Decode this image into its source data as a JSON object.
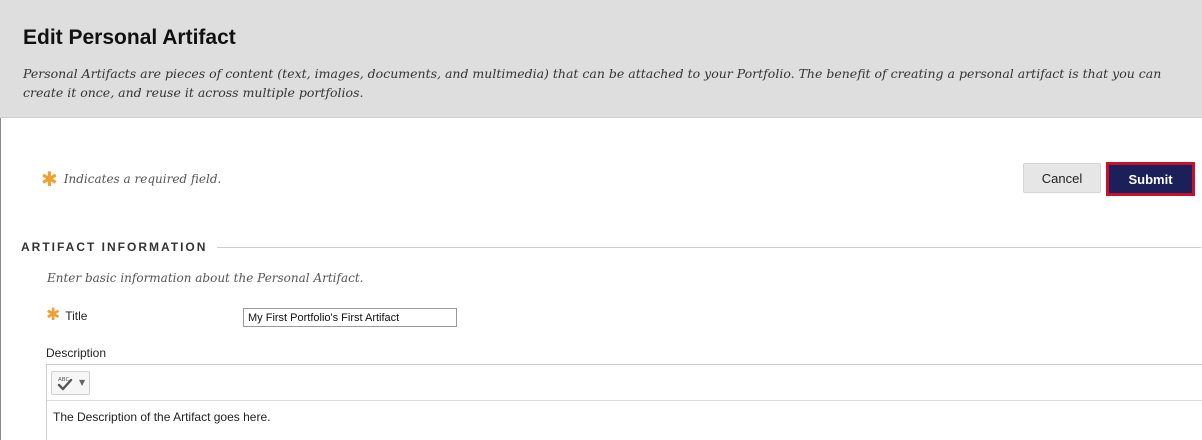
{
  "header": {
    "title": "Edit Personal Artifact",
    "description": "Personal Artifacts are pieces of content (text, images, documents, and multimedia) that can be attached to your Portfolio. The benefit of creating a personal artifact is that you can create it once, and reuse it across multiple portfolios."
  },
  "required_note": {
    "icon": "asterisk-icon",
    "text": "Indicates a required field."
  },
  "actions": {
    "cancel_label": "Cancel",
    "submit_label": "Submit"
  },
  "section": {
    "title": "ARTIFACT INFORMATION",
    "help": "Enter basic information about the Personal Artifact."
  },
  "fields": {
    "title_label": "Title",
    "title_value": "My First Portfolio's First Artifact",
    "description_label": "Description",
    "description_value": "The Description of the Artifact goes here."
  },
  "editor_toolbar": {
    "spellcheck_icon": "spellcheck-icon",
    "dropdown_icon": "chevron-down-icon"
  },
  "colors": {
    "header_bg": "#dedede",
    "required_star": "#f0a030",
    "submit_bg": "#1b1f5a",
    "submit_highlight": "#c8102e"
  }
}
